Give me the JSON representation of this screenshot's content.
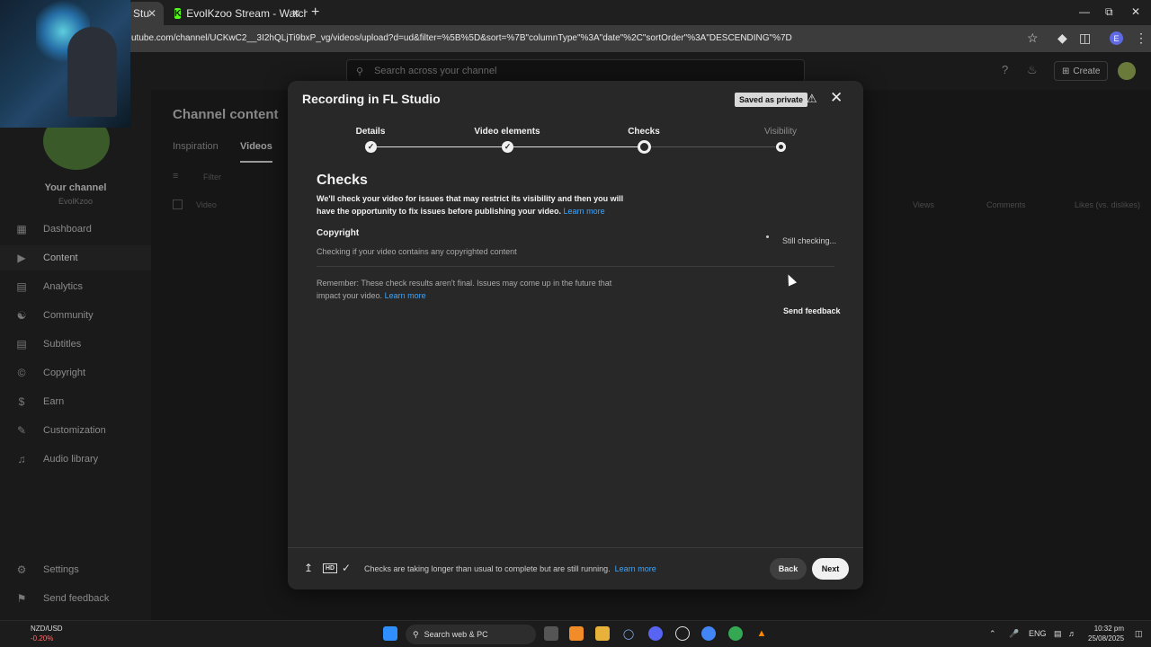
{
  "browser": {
    "tabs": [
      {
        "label": "Stu"
      },
      {
        "label": "EvolKzoo Stream - Watch Live o"
      }
    ],
    "new_tab": "+",
    "url": "utube.com/channel/UCKwC2__3I2hQLjTi9bxP_vg/videos/upload?d=ud&filter=%5B%5D&sort=%7B\"columnType\"%3A\"date\"%2C\"sortOrder\"%3A\"DESCENDING\"%7D",
    "profile_initial": "E",
    "kick_favicon": "K"
  },
  "studio": {
    "search_placeholder": "Search across your channel",
    "create_label": "Create",
    "channel_name": "Your channel",
    "channel_handle": "EvolKzoo",
    "page_title": "Channel content",
    "tabs": [
      "Inspiration",
      "Videos"
    ],
    "filter_label": "Filter",
    "columns": {
      "video": "Video",
      "views": "Views",
      "comments": "Comments",
      "likes": "Likes (vs. dislikes)"
    },
    "nav": [
      {
        "label": "Dashboard",
        "icon": "dashboard-icon"
      },
      {
        "label": "Content",
        "icon": "content-icon"
      },
      {
        "label": "Analytics",
        "icon": "analytics-icon"
      },
      {
        "label": "Community",
        "icon": "community-icon"
      },
      {
        "label": "Subtitles",
        "icon": "subtitles-icon"
      },
      {
        "label": "Copyright",
        "icon": "copyright-icon"
      },
      {
        "label": "Earn",
        "icon": "earn-icon"
      },
      {
        "label": "Customization",
        "icon": "customization-icon"
      },
      {
        "label": "Audio library",
        "icon": "audio-library-icon"
      }
    ],
    "settings_label": "Settings",
    "send_feedback_label": "Send feedback"
  },
  "modal": {
    "title": "Recording in FL Studio",
    "saved_badge": "Saved as private",
    "steps": [
      "Details",
      "Video elements",
      "Checks",
      "Visibility"
    ],
    "heading": "Checks",
    "description": "We'll check your video for issues that may restrict its visibility and then you will have the opportunity to fix issues before publishing your video.",
    "learn_more": "Learn more",
    "copyright_title": "Copyright",
    "copyright_sub": "Checking if your video contains any copyrighted content",
    "status": "Still checking...",
    "remember": "Remember: These check results aren't final. Issues may come up in the future that impact your video.",
    "send_feedback": "Send feedback",
    "footer_text": "Checks are taking longer than usual to complete but are still running.",
    "footer_hd": "HD",
    "back_label": "Back",
    "next_label": "Next"
  },
  "taskbar": {
    "ticker": "NZD/USD",
    "ticker_change": "-0.20%",
    "search_label": "Search web & PC",
    "lang": "ENG",
    "time": "10:32 pm",
    "date": "25/08/2025"
  }
}
